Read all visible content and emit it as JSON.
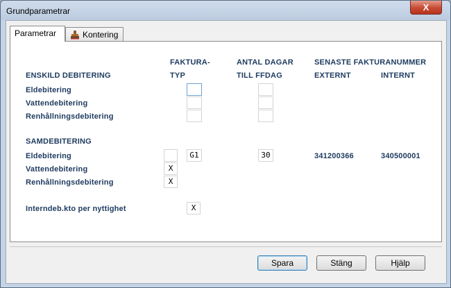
{
  "window": {
    "title": "Grundparametrar",
    "close_glyph": "X"
  },
  "tabs": [
    {
      "label": "Parametrar",
      "active": true
    },
    {
      "label": "Kontering",
      "active": false,
      "icon": "stamp-icon"
    }
  ],
  "headers": {
    "faktura_typ_line1": "FAKTURA-",
    "faktura_typ_line2": "TYP",
    "antal_dagar_line1": "ANTAL DAGAR",
    "antal_dagar_line2": "TILL FFDAG",
    "senaste_fakturanummer": "SENASTE FAKTURANUMMER",
    "externt": "EXTERNT",
    "internt": "INTERNT"
  },
  "enskild": {
    "title": "ENSKILD DEBITERING",
    "rows": [
      {
        "label": "Eldebitering",
        "fakturatyp": "",
        "antal_dagar": ""
      },
      {
        "label": "Vattendebitering",
        "fakturatyp": "",
        "antal_dagar": ""
      },
      {
        "label": "Renhållningsdebitering",
        "fakturatyp": "",
        "antal_dagar": ""
      }
    ]
  },
  "samdebitering": {
    "title": "SAMDEBITERING",
    "rows": [
      {
        "label": "Eldebitering",
        "check": "",
        "fakturatyp": "G1",
        "antal_dagar": "30",
        "externt": "341200366",
        "internt": "340500001"
      },
      {
        "label": "Vattendebitering",
        "check": "X"
      },
      {
        "label": "Renhållningsdebitering",
        "check": "X"
      }
    ]
  },
  "interndeb": {
    "label": "Interndeb.kto per nyttighet",
    "value": "X"
  },
  "buttons": {
    "spara": "Spara",
    "stang": "Stäng",
    "hjalp": "Hjälp"
  },
  "colors": {
    "label_blue": "#1f3c60",
    "window_frame": "#c4d3e6",
    "close_red": "#c64a34"
  }
}
